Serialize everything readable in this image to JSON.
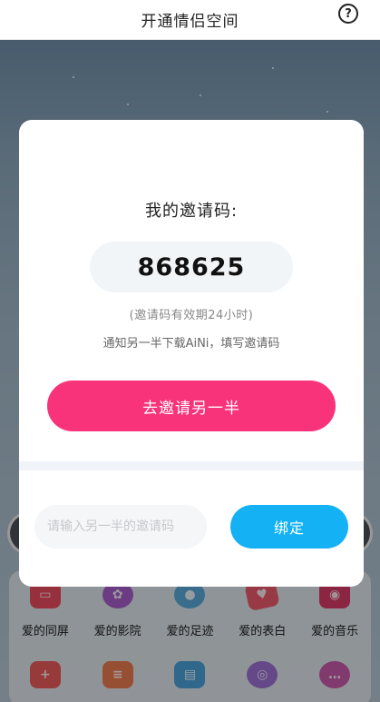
{
  "header": {
    "title": "开通情侣空间",
    "help_glyph": "?"
  },
  "modal": {
    "title": "我的邀请码:",
    "code": "868625",
    "validity": "(邀请码有效期24小时)",
    "instruction": "通知另一半下载AiNi，填写邀请码",
    "invite_button": "去邀请另一半",
    "input_placeholder": "请输入另一半的邀请码",
    "input_value": "",
    "bind_button": "绑定"
  },
  "features": {
    "row1": [
      {
        "label": "爱的同屏",
        "icon": "screen-share-icon",
        "color": "#e84a5f"
      },
      {
        "label": "爱的影院",
        "icon": "film-reel-icon",
        "color": "#a55cc7"
      },
      {
        "label": "爱的足迹",
        "icon": "map-pin-icon",
        "color": "#5aa8d6"
      },
      {
        "label": "爱的表白",
        "icon": "love-letter-icon",
        "color": "#e8596a"
      },
      {
        "label": "爱的音乐",
        "icon": "music-note-icon",
        "color": "#d63a64"
      }
    ],
    "row2": [
      {
        "label": "",
        "icon": "add-card-icon",
        "color": "#e85a5a"
      },
      {
        "label": "",
        "icon": "document-icon",
        "color": "#e87a50"
      },
      {
        "label": "",
        "icon": "gift-box-icon",
        "color": "#4aa0d8"
      },
      {
        "label": "",
        "icon": "camera-icon",
        "color": "#9a6fd0"
      },
      {
        "label": "",
        "icon": "chat-bubble-icon",
        "color": "#c75aa8"
      }
    ]
  },
  "colors": {
    "invite_button": "#f8337a",
    "bind_button": "#14b1f5",
    "code_box": "#f2f5f8"
  }
}
